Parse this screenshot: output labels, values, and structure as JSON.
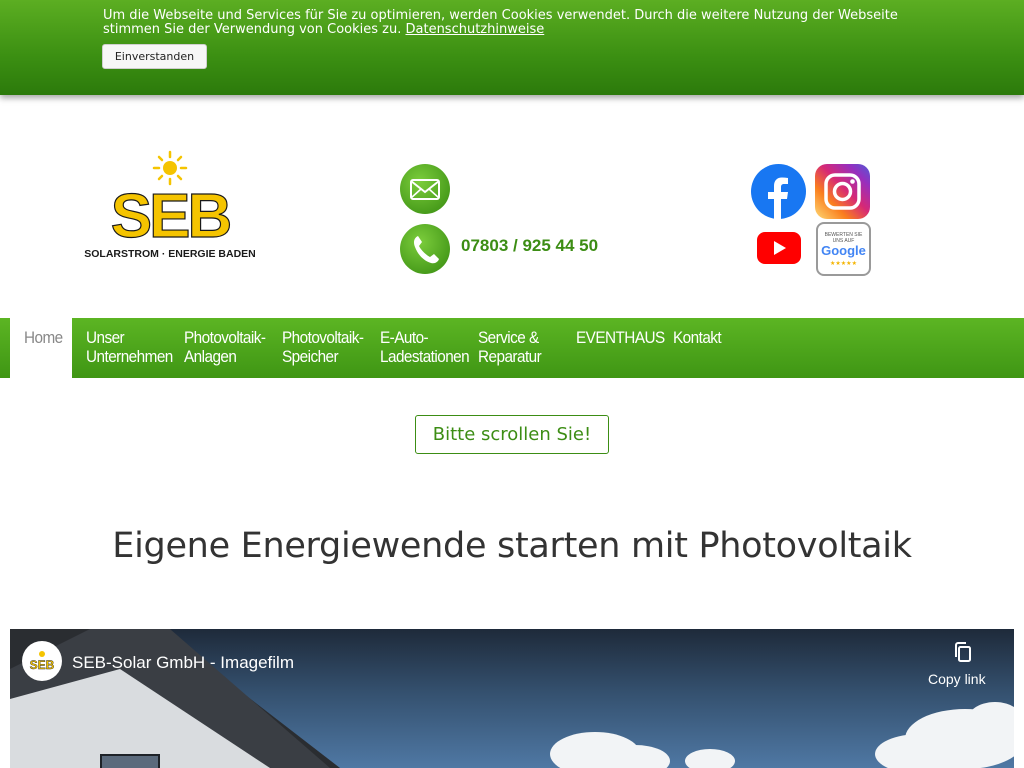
{
  "cookie": {
    "text": "Um die Webseite und Services für Sie zu optimieren, werden Cookies verwendet. Durch die weitere Nutzung der Webseite stimmen Sie der Verwendung von Cookies zu.",
    "link": "Datenschutzhinweise",
    "button": "Einverstanden"
  },
  "header": {
    "logo_text": "SEB",
    "logo_tagline": "SOLARSTROM · ENERGIE BADEN",
    "phone": "07803 / 925 44 50",
    "icons": [
      "mail-icon",
      "phone-icon",
      "facebook-icon",
      "instagram-icon",
      "youtube-icon",
      "google-review-icon"
    ],
    "google_badge": [
      "BEWERTEN SIE",
      "UNS AUF",
      "Google",
      "★★★★★"
    ]
  },
  "nav": {
    "home": "Home",
    "items": [
      {
        "line1": "Unser",
        "line2": "Unternehmen"
      },
      {
        "line1": "Photovoltaik-",
        "line2": "Anlagen"
      },
      {
        "line1": "Photovoltaik-",
        "line2": "Speicher"
      },
      {
        "line1": "E-Auto-",
        "line2": "Ladestationen"
      },
      {
        "line1": "Service &",
        "line2": "Reparatur"
      },
      {
        "line1": "EVENTHAUS",
        "line2": ""
      },
      {
        "line1": "Kontakt",
        "line2": ""
      }
    ]
  },
  "main": {
    "scroll_button": "Bitte scrollen Sie!",
    "headline": "Eigene Energiewende starten mit Photovoltaik"
  },
  "video": {
    "title": "SEB-Solar GmbH - Imagefilm",
    "copy_link": "Copy link",
    "avatar_text": "SEB"
  },
  "colors": {
    "brand_green": "#3c8d14",
    "logo_yellow": "#f5c400"
  }
}
